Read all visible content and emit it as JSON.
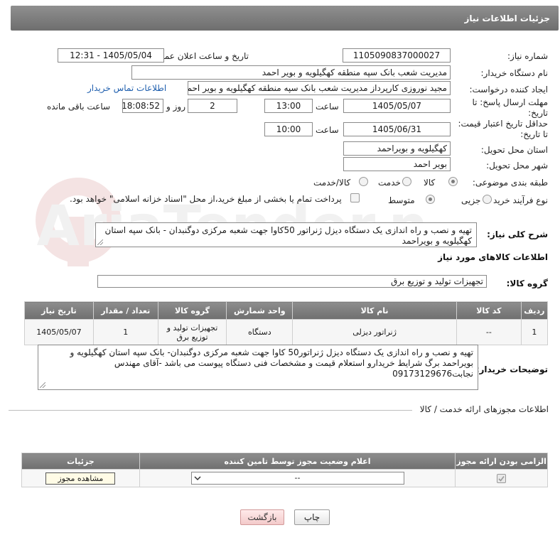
{
  "header": {
    "title": "جزئیات اطلاعات نیاز"
  },
  "form": {
    "need_number": {
      "label": "شماره نیاز:",
      "value": "1105090837000027"
    },
    "announce_datetime": {
      "label": "تاریخ و ساعت اعلان عمومی:",
      "value": "1405/05/04 - 12:31"
    },
    "buyer_org": {
      "label": "نام دستگاه خریدار:",
      "value": "مدیریت شعب بانک سپه منطقه کهگیلویه و بویر احمد"
    },
    "requester": {
      "label": "ایجاد کننده درخواست:",
      "value": "مجید نوروزی کارپرداز مدیریت شعب بانک سپه منطقه کهگیلویه و بویر احمد",
      "contact_link": "اطلاعات تماس خریدار"
    },
    "send_deadline": {
      "label_line1": "مهلت ارسال پاسخ: تا",
      "label_line2": "تاریخ:",
      "date": "1405/05/07",
      "time_label": "ساعت",
      "time": "13:00",
      "days": "2",
      "days_label": "روز و",
      "remaining": "18:08:52",
      "remaining_label": "ساعت باقی مانده"
    },
    "price_validity": {
      "label_line1": "حداقل تاریخ اعتبار قیمت:",
      "label_line2": "تا تاریخ:",
      "date": "1405/06/31",
      "time_label": "ساعت",
      "time": "10:00"
    },
    "delivery_province": {
      "label": "استان محل تحویل:",
      "value": "کهگیلویه و بویراحمد"
    },
    "delivery_city": {
      "label": "شهر محل تحویل:",
      "value": "بویر احمد"
    },
    "category": {
      "label": "طبقه بندی موضوعی:",
      "options": [
        "کالا",
        "خدمت",
        "کالا/خدمت"
      ],
      "selected": "کالا"
    },
    "purchase_type": {
      "label": "نوع فرآیند خرید :",
      "options": [
        "جزیی",
        "متوسط"
      ],
      "selected": "متوسط",
      "treasury_note": "پرداخت تمام یا بخشی از مبلغ خرید،از محل \"اسناد خزانه اسلامی\" خواهد بود."
    }
  },
  "description": {
    "label": "شرح کلی نیاز:",
    "value": "تهیه و نصب و راه اندازی یک دستگاه دیزل ژنراتور 50کاوا جهت شعبه مرکزی دوگنبدان - بانک سپه استان کهگیلویه و بویراحمد"
  },
  "goods_section": {
    "title": "اطلاعات کالاهای مورد نیاز",
    "group_label": "گروه کالا:",
    "group_value": "تجهیزات تولید و توزیع برق",
    "columns": [
      "ردیف",
      "کد کالا",
      "نام کالا",
      "واحد شمارش",
      "گروه کالا",
      "تعداد / مقدار",
      "تاریخ نیاز"
    ],
    "rows": [
      {
        "row": "1",
        "code": "--",
        "name": "ژنراتور دیزلی",
        "unit": "دستگاه",
        "group": "تجهیزات تولید و توزیع برق",
        "qty": "1",
        "date": "1405/05/07"
      }
    ]
  },
  "buyer_notes": {
    "label": "توضیحات خریدار:",
    "value": "تهیه و نصب و راه اندازی یک دستگاه دیزل ژنراتور50  کاوا جهت شعبه مرکزی دوگنبدان- بانک سپه استان کهگیلویه و بویراحمد برگ شرایط خریدارو استعلام قیمت و مشخصات فنی دستگاه پیوست می باشد  -آقای مهندس  نجابت09173129676"
  },
  "permits_section": {
    "title": "اطلاعات مجوزهای ارائه خدمت / کالا",
    "columns": [
      "الزامی بودن ارائه مجوز",
      "اعلام وضعیت مجوز توسط تامین کننده",
      "جزئیات"
    ],
    "row": {
      "status_value": "--",
      "details_button": "مشاهده مجوز"
    }
  },
  "footer": {
    "print_button": "چاپ",
    "back_button": "بازگشت"
  },
  "watermark_text": "AriaTender.neT"
}
